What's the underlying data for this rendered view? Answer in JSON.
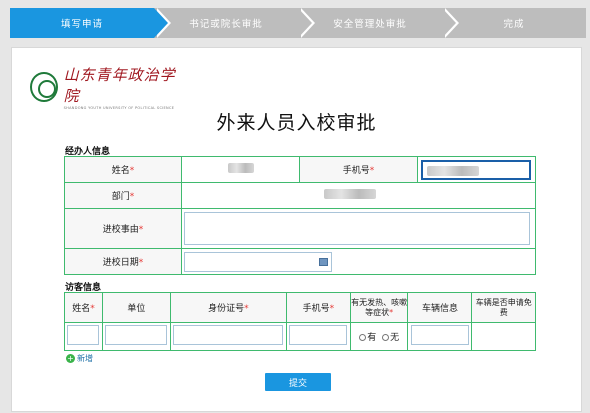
{
  "steps": [
    {
      "label": "填写申请",
      "active": true
    },
    {
      "label": "书记或院长审批",
      "active": false
    },
    {
      "label": "安全管理处审批",
      "active": false
    },
    {
      "label": "完成",
      "active": false
    }
  ],
  "logo": {
    "cn": "山东青年政治学院",
    "en": "SHANDONG YOUTH UNIVERSITY OF POLITICAL SCIENCE"
  },
  "title": "外来人员入校审批",
  "handler": {
    "section_label": "经办人信息",
    "name_label": "姓名",
    "phone_label": "手机号",
    "dept_label": "部门",
    "reason_label": "进校事由",
    "date_label": "进校日期",
    "required_mark": "*"
  },
  "visitor": {
    "section_label": "访客信息",
    "columns": [
      "姓名",
      "单位",
      "身份证号",
      "手机号",
      "有无发热、咳嗽等症状",
      "车辆信息",
      "车辆是否申请免费"
    ],
    "required_mark": "*",
    "radio_yes": "有",
    "radio_no": "无",
    "add_label": "新增"
  },
  "submit_label": "提交"
}
